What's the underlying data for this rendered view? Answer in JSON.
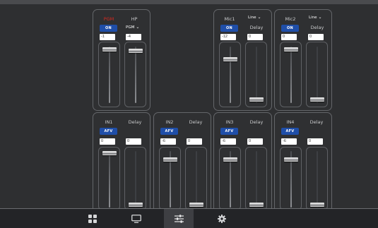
{
  "panels": {
    "pgm_hp": {
      "col1": {
        "title": "PGM",
        "button": "ON",
        "value": "-1"
      },
      "col2": {
        "title": "HP",
        "dropdown": "PGM",
        "value": "-4"
      }
    },
    "mic1": {
      "col1": {
        "title": "Mic1",
        "button": "ON",
        "value": "-12",
        "level": 0.72
      },
      "col2": {
        "title": "Delay",
        "dropdown": "Line",
        "value": "0",
        "level": 0.0
      }
    },
    "mic2": {
      "col1": {
        "title": "Mic2",
        "button": "ON",
        "value": "0",
        "level": 0.95
      },
      "col2": {
        "title": "Delay",
        "dropdown": "Line",
        "value": "0",
        "level": 0.0
      }
    },
    "in1": {
      "col1": {
        "title": "IN1",
        "button": "AFV",
        "value": "0",
        "level": 0.95
      },
      "col2": {
        "title": "Delay",
        "value": "0",
        "level": 0.0
      }
    },
    "in2": {
      "col1": {
        "title": "IN2",
        "button": "AFV",
        "value": "-6",
        "level": 0.83
      },
      "col2": {
        "title": "Delay",
        "value": "0",
        "level": 0.0
      }
    },
    "in3": {
      "col1": {
        "title": "IN3",
        "button": "AFV",
        "value": "-6",
        "level": 0.83
      },
      "col2": {
        "title": "Delay",
        "value": "0",
        "level": 0.0
      }
    },
    "in4": {
      "col1": {
        "title": "IN4",
        "button": "AFV",
        "value": "-6",
        "level": 0.83
      },
      "col2": {
        "title": "Delay",
        "value": "0",
        "level": 0.0
      }
    }
  },
  "pgm_levels": {
    "pgm": 0.95,
    "hp": 0.92
  },
  "nav": {
    "items": [
      {
        "icon": "grid-icon",
        "active": false
      },
      {
        "icon": "monitor-icon",
        "active": false
      },
      {
        "icon": "sliders-icon",
        "active": true
      },
      {
        "icon": "gear-icon",
        "active": false
      }
    ]
  },
  "colors": {
    "accent_blue": "#1f4ea8",
    "pgm_red": "#d9281e",
    "background": "#2e2f31"
  }
}
